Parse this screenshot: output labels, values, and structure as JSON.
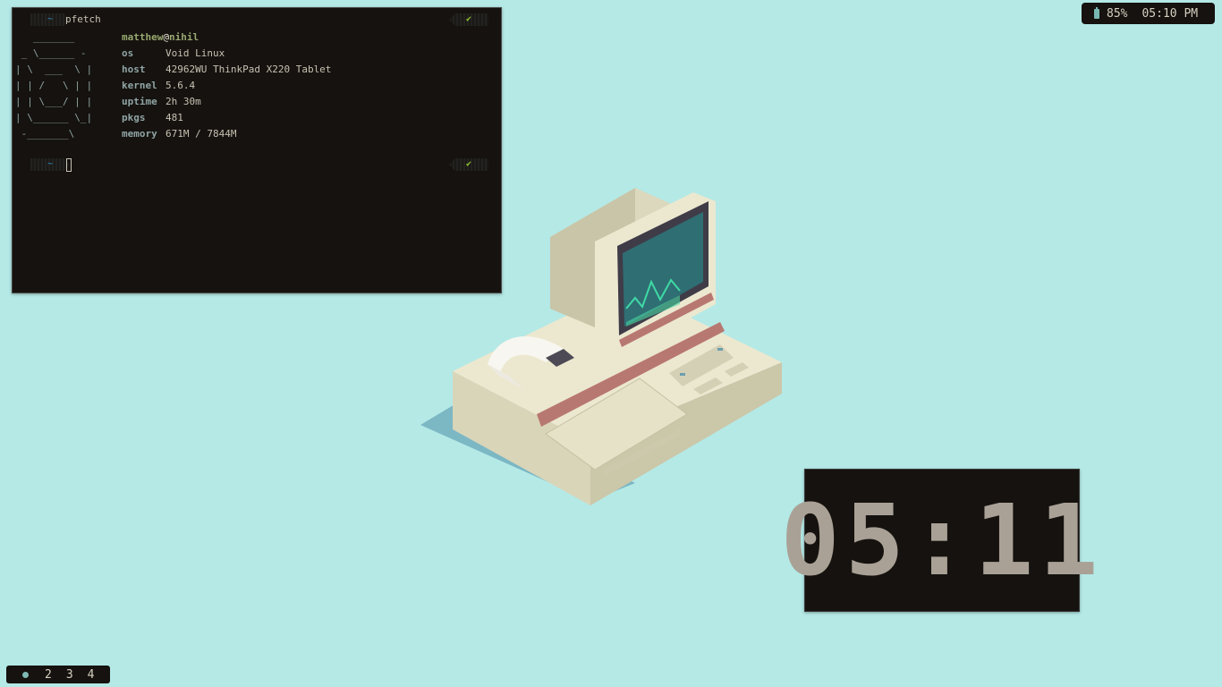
{
  "terminal": {
    "prompt1": {
      "dir": "~",
      "command": "pfetch",
      "status": "✔"
    },
    "prompt2": {
      "dir": "~",
      "status": "✔"
    },
    "ascii": "   _______\n _ \\______ -\n| \\  ___  \\ |\n| | /   \\ | |\n| | \\___/ | |\n| \\______ \\_|\n -_______\\",
    "user": "matthew",
    "at": "@",
    "host_name": "nihil",
    "fields": [
      {
        "key": "os",
        "value": "Void Linux"
      },
      {
        "key": "host",
        "value": "42962WU ThinkPad X220 Tablet"
      },
      {
        "key": "kernel",
        "value": "5.6.4"
      },
      {
        "key": "uptime",
        "value": "2h 30m"
      },
      {
        "key": "pkgs",
        "value": "481"
      },
      {
        "key": "memory",
        "value": "671M / 7844M"
      }
    ]
  },
  "statusbar": {
    "battery": "85%",
    "time": "05:10 PM",
    "battery_icon": "battery-icon"
  },
  "workspaces": {
    "items": [
      "2",
      "3",
      "4"
    ],
    "active_icon": "dot-icon"
  },
  "clock": {
    "time": "05:11"
  },
  "colors": {
    "background": "#b4e9e6",
    "terminal_bg": "#15120f",
    "accent_blue": "#2b9bd1",
    "accent_green": "#8ec431"
  }
}
